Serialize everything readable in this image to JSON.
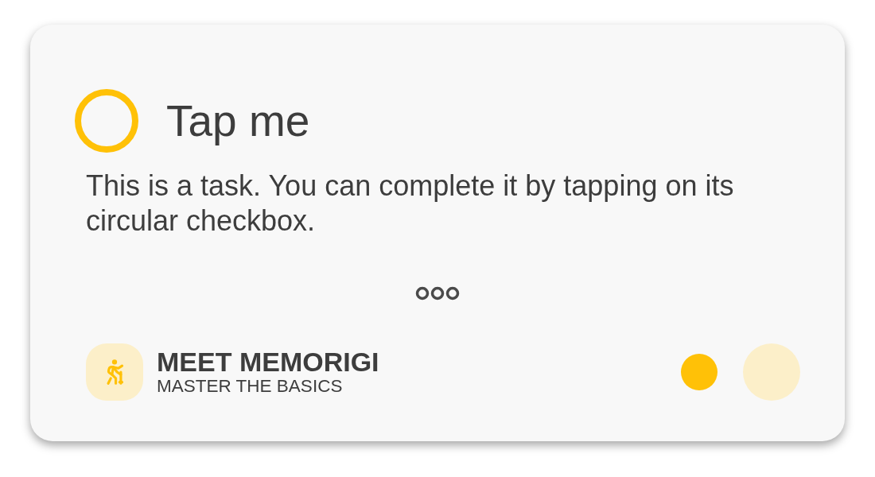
{
  "task": {
    "title": "Tap me",
    "completed": false,
    "description": "This is a task. You can complete it by tapping on its circular checkbox."
  },
  "list": {
    "title": "MEET MEMORIGI",
    "subtitle": "MASTER THE BASICS"
  }
}
